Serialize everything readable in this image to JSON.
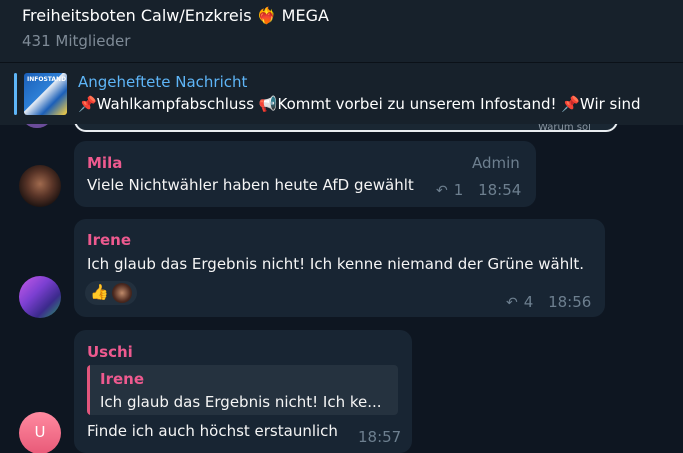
{
  "header": {
    "title_prefix": "Freiheitsboten Calw/Enzkreis",
    "heart_icon": "❤️‍🔥",
    "title_suffix": "MEGA",
    "subtitle": "431 Mitglieder"
  },
  "pinned": {
    "title": "Angeheftete Nachricht",
    "thumb_text": "INFOSTAND",
    "text": "📌Wahlkampfabschluss  📢Kommt vorbei zu unserem Infostand!  📌Wir sind"
  },
  "peek": {
    "text": "Warum sol"
  },
  "messages": [
    {
      "sender": "Mila",
      "sender_color": "#ee5a8f",
      "admin": "Admin",
      "text": "Viele Nichtwähler haben heute AfD gewählt",
      "forwards": "1",
      "time": "18:54"
    },
    {
      "sender": "Irene",
      "sender_color": "#ee5a8f",
      "text": "Ich glaub das Ergebnis nicht! Ich kenne niemand der Grüne wählt.",
      "reaction": "👍",
      "forwards": "4",
      "time": "18:56"
    },
    {
      "sender": "Uschi",
      "sender_color": "#ee5a8f",
      "avatar_letter": "U",
      "reply_sender": "Irene",
      "reply_text": "Ich glaub das Ergebnis nicht! Ich ke...",
      "text": "Finde ich auch höchst erstaunlich",
      "time": "18:57"
    }
  ]
}
